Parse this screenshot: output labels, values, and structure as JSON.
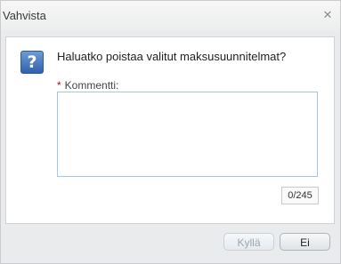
{
  "dialog": {
    "title": "Vahvista",
    "close_icon": "close-icon",
    "question_icon": "question-icon",
    "question": "Haluatko poistaa valitut maksusuunnitelmat?",
    "comment": {
      "required_mark": "*",
      "label": "Kommentti:",
      "value": "",
      "counter": "0/245"
    },
    "buttons": {
      "yes": "Kyllä",
      "no": "Ei"
    }
  }
}
